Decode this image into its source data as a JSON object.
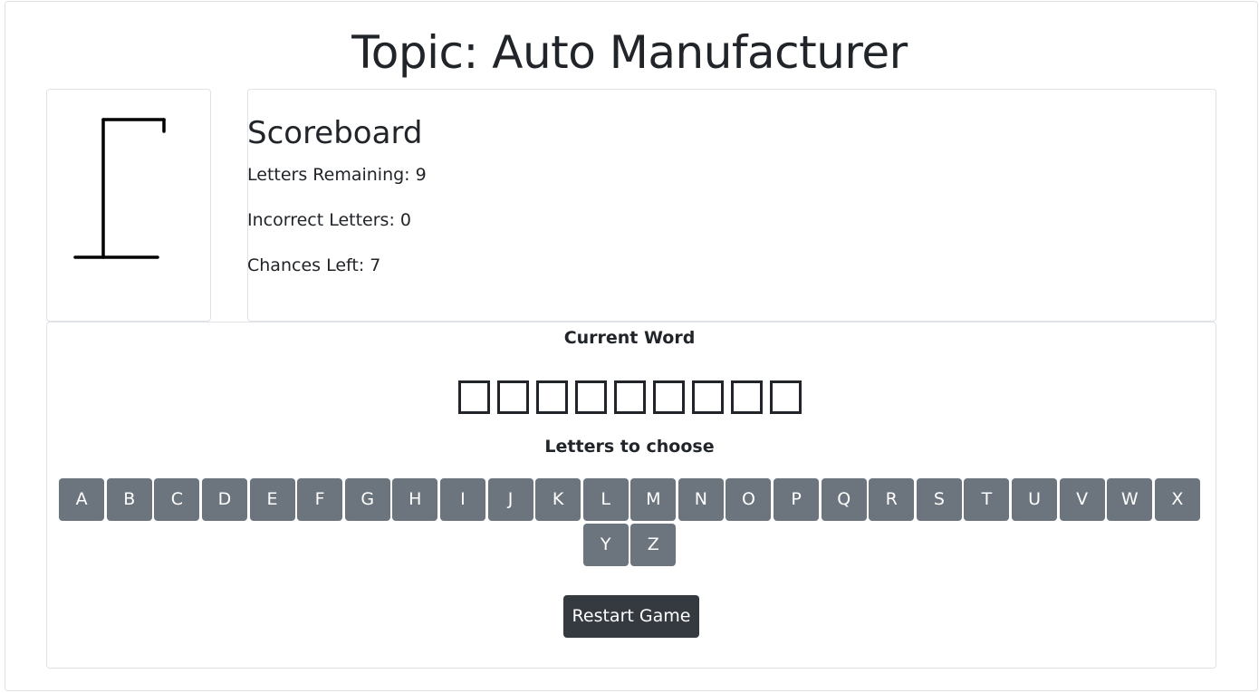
{
  "title": "Topic: Auto Manufacturer",
  "scoreboard": {
    "heading": "Scoreboard",
    "letters_remaining": "Letters Remaining: 9",
    "incorrect_letters": "Incorrect Letters: 0",
    "chances_left": "Chances Left: 7"
  },
  "word": {
    "label": "Current Word",
    "slot_count": 9
  },
  "letters": {
    "label": "Letters to choose",
    "row1": [
      "A",
      "B",
      "C",
      "D",
      "E",
      "F",
      "G",
      "H",
      "I",
      "J",
      "K",
      "L",
      "M",
      "N",
      "O",
      "P",
      "Q",
      "R",
      "S",
      "T",
      "U",
      "V",
      "W",
      "X"
    ],
    "row2": [
      "Y",
      "Z"
    ]
  },
  "restart_label": "Restart Game",
  "colors": {
    "letter_button": "#6c757d",
    "restart_button": "#343a40",
    "text": "#212529"
  }
}
